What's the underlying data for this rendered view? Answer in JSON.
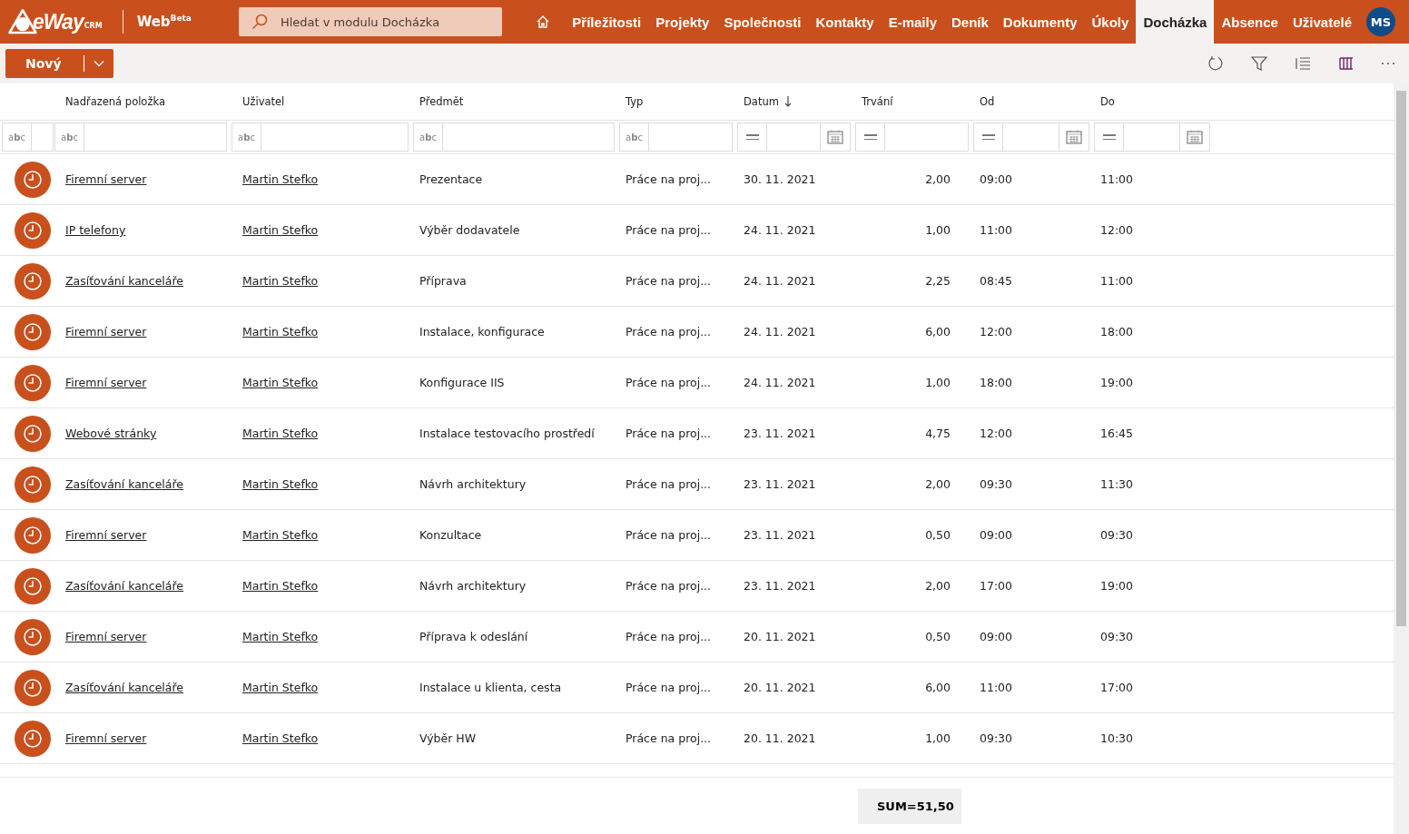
{
  "logo": {
    "brand": "eWay",
    "sub": "CRM"
  },
  "product": {
    "name": "Web",
    "tag": "Beta"
  },
  "search": {
    "placeholder": "Hledat v modulu Docházka"
  },
  "nav": [
    {
      "label": "Příležitosti",
      "selected": false
    },
    {
      "label": "Projekty",
      "selected": false
    },
    {
      "label": "Společnosti",
      "selected": false
    },
    {
      "label": "Kontakty",
      "selected": false
    },
    {
      "label": "E-maily",
      "selected": false
    },
    {
      "label": "Deník",
      "selected": false
    },
    {
      "label": "Dokumenty",
      "selected": false
    },
    {
      "label": "Úkoly",
      "selected": false
    },
    {
      "label": "Docházka",
      "selected": true
    },
    {
      "label": "Absence",
      "selected": false
    },
    {
      "label": "Uživatelé",
      "selected": false
    }
  ],
  "avatar": "MS",
  "new_button": "Nový",
  "columns": [
    {
      "label": "Nadřazená položka",
      "sorted_descending": false
    },
    {
      "label": "Uživatel",
      "sorted_descending": false
    },
    {
      "label": "Předmět",
      "sorted_descending": false
    },
    {
      "label": "Typ",
      "sorted_descending": false
    },
    {
      "label": "Datum",
      "sorted_descending": true
    },
    {
      "label": "Trvání",
      "sorted_descending": false
    },
    {
      "label": "Od",
      "sorted_descending": false
    },
    {
      "label": "Do",
      "sorted_descending": false
    }
  ],
  "filters": [
    {
      "kind": "icon-text",
      "icon_text": "a**b**c"
    },
    {
      "kind": "text",
      "icon_text": "a**b**c"
    },
    {
      "kind": "text",
      "icon_text": "a**b**c"
    },
    {
      "kind": "text",
      "icon_text": "a**b**c"
    },
    {
      "kind": "text",
      "icon_text": "a**b**c"
    },
    {
      "kind": "date"
    },
    {
      "kind": "number"
    },
    {
      "kind": "date"
    },
    {
      "kind": "date"
    }
  ],
  "rows": [
    {
      "parent": "Firemní server",
      "user": "Martin Stefko",
      "subject": "Prezentace",
      "type": "Práce na proj...",
      "date": "30. 11. 2021",
      "duration": "2,00",
      "from": "09:00",
      "to": "11:00"
    },
    {
      "parent": "IP telefony",
      "user": "Martin Stefko",
      "subject": "Výběr dodavatele",
      "type": "Práce na proj...",
      "date": "24. 11. 2021",
      "duration": "1,00",
      "from": "11:00",
      "to": "12:00"
    },
    {
      "parent": "Zasíťování kanceláře",
      "user": "Martin Stefko",
      "subject": "Příprava",
      "type": "Práce na proj...",
      "date": "24. 11. 2021",
      "duration": "2,25",
      "from": "08:45",
      "to": "11:00"
    },
    {
      "parent": "Firemní server",
      "user": "Martin Stefko",
      "subject": "Instalace, konfigurace",
      "type": "Práce na proj...",
      "date": "24. 11. 2021",
      "duration": "6,00",
      "from": "12:00",
      "to": "18:00"
    },
    {
      "parent": "Firemní server",
      "user": "Martin Stefko",
      "subject": "Konfigurace IIS",
      "type": "Práce na proj...",
      "date": "24. 11. 2021",
      "duration": "1,00",
      "from": "18:00",
      "to": "19:00"
    },
    {
      "parent": "Webové stránky",
      "user": "Martin Stefko",
      "subject": "Instalace testovacího prostředí",
      "type": "Práce na proj...",
      "date": "23. 11. 2021",
      "duration": "4,75",
      "from": "12:00",
      "to": "16:45"
    },
    {
      "parent": "Zasíťování kanceláře",
      "user": "Martin Stefko",
      "subject": "Návrh architektury",
      "type": "Práce na proj...",
      "date": "23. 11. 2021",
      "duration": "2,00",
      "from": "09:30",
      "to": "11:30"
    },
    {
      "parent": "Firemní server",
      "user": "Martin Stefko",
      "subject": "Konzultace",
      "type": "Práce na proj...",
      "date": "23. 11. 2021",
      "duration": "0,50",
      "from": "09:00",
      "to": "09:30"
    },
    {
      "parent": "Zasíťování kanceláře",
      "user": "Martin Stefko",
      "subject": "Návrh architektury",
      "type": "Práce na proj...",
      "date": "23. 11. 2021",
      "duration": "2,00",
      "from": "17:00",
      "to": "19:00"
    },
    {
      "parent": "Firemní server",
      "user": "Martin Stefko",
      "subject": "Příprava k odeslání",
      "type": "Práce na proj...",
      "date": "20. 11. 2021",
      "duration": "0,50",
      "from": "09:00",
      "to": "09:30"
    },
    {
      "parent": "Zasíťování kanceláře",
      "user": "Martin Stefko",
      "subject": "Instalace u klienta, cesta",
      "type": "Práce na proj...",
      "date": "20. 11. 2021",
      "duration": "6,00",
      "from": "11:00",
      "to": "17:00"
    },
    {
      "parent": "Firemní server",
      "user": "Martin Stefko",
      "subject": "Výběr HW",
      "type": "Práce na proj...",
      "date": "20. 11. 2021",
      "duration": "1,00",
      "from": "09:30",
      "to": "10:30"
    }
  ],
  "sum": "SUM=51,50"
}
